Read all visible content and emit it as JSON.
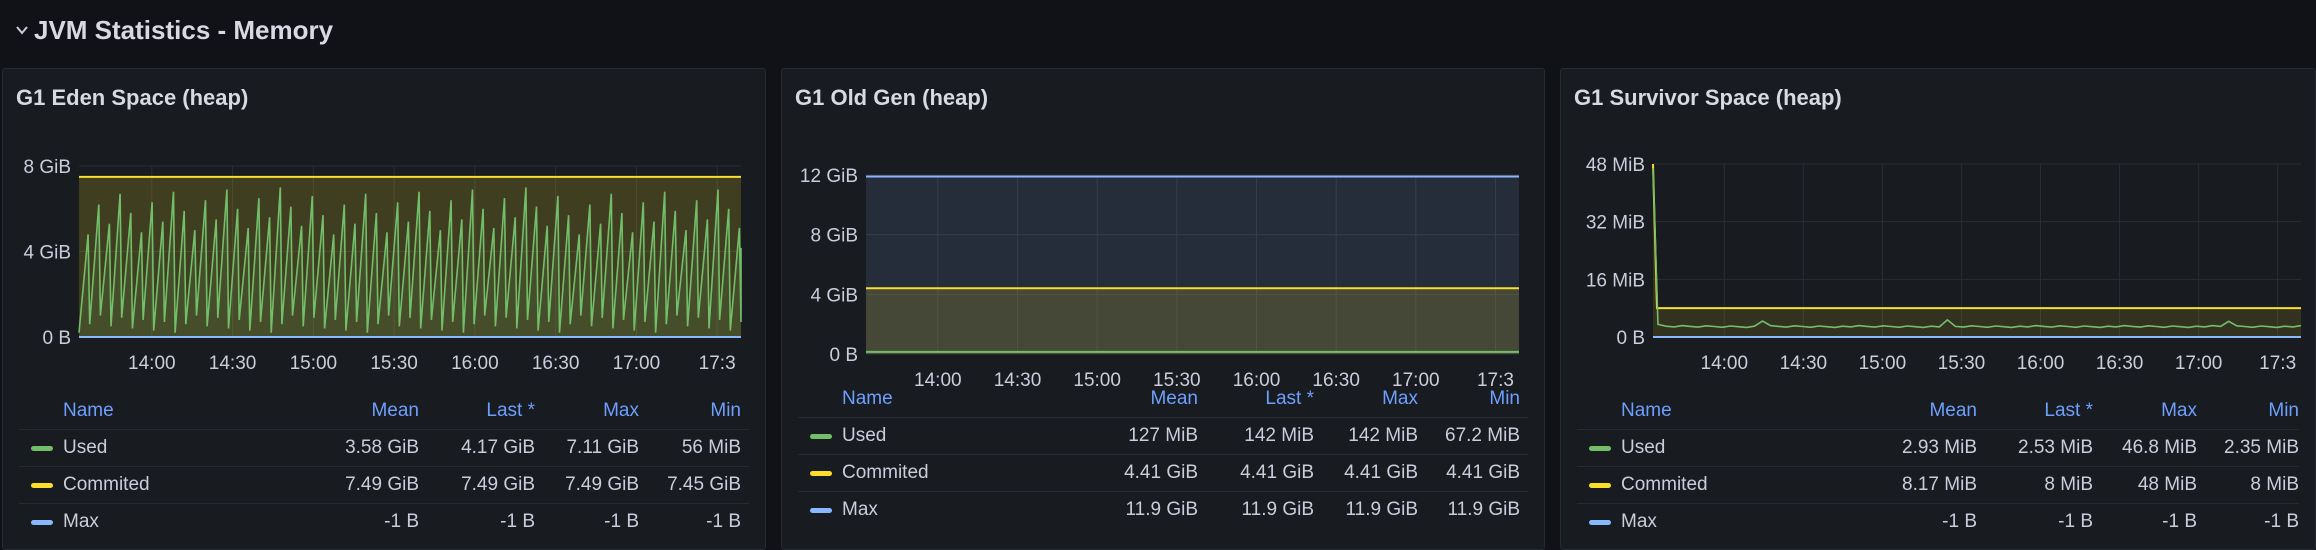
{
  "row": {
    "title": "JVM Statistics - Memory"
  },
  "legend_header": {
    "name": "Name",
    "mean": "Mean",
    "last": "Last *",
    "max": "Max",
    "min": "Min"
  },
  "colors": {
    "used": "#73bf69",
    "commited": "#fade2a",
    "max": "#8ab8ff",
    "grid": "#2a2d33",
    "axis_text": "#ccccdc"
  },
  "panels": [
    {
      "title": "G1 Eden Space (heap)",
      "chart_data": {
        "type": "line",
        "yticks": [
          "8 GiB",
          "4 GiB",
          "0 B"
        ],
        "ylim": [
          0,
          8
        ],
        "xticks": [
          "14:00",
          "14:30",
          "15:00",
          "15:30",
          "16:00",
          "16:30",
          "17:00",
          "17:3"
        ],
        "series": [
          {
            "name": "Used",
            "pattern": "sawtooth",
            "min_gib": 0.05,
            "max_gib": 7.11,
            "last_gib": 4.17
          },
          {
            "name": "Commited",
            "value_gib": 7.49
          },
          {
            "name": "Max",
            "value_gib": 0
          }
        ]
      },
      "legend": [
        {
          "name": "Used",
          "mean": "3.58 GiB",
          "last": "4.17 GiB",
          "max": "7.11 GiB",
          "min": "56 MiB"
        },
        {
          "name": "Commited",
          "mean": "7.49 GiB",
          "last": "7.49 GiB",
          "max": "7.49 GiB",
          "min": "7.45 GiB"
        },
        {
          "name": "Max",
          "mean": "-1 B",
          "last": "-1 B",
          "max": "-1 B",
          "min": "-1 B"
        }
      ]
    },
    {
      "title": "G1 Old Gen (heap)",
      "chart_data": {
        "type": "line",
        "yticks": [
          "12 GiB",
          "8 GiB",
          "4 GiB",
          "0 B"
        ],
        "ylim": [
          0,
          12
        ],
        "xticks": [
          "14:00",
          "14:30",
          "15:00",
          "15:30",
          "16:00",
          "16:30",
          "17:00",
          "17:3"
        ],
        "series": [
          {
            "name": "Used",
            "value_gib": 0.14
          },
          {
            "name": "Commited",
            "value_gib": 4.41
          },
          {
            "name": "Max",
            "value_gib": 11.9
          }
        ]
      },
      "legend": [
        {
          "name": "Used",
          "mean": "127 MiB",
          "last": "142 MiB",
          "max": "142 MiB",
          "min": "67.2 MiB"
        },
        {
          "name": "Commited",
          "mean": "4.41 GiB",
          "last": "4.41 GiB",
          "max": "4.41 GiB",
          "min": "4.41 GiB"
        },
        {
          "name": "Max",
          "mean": "11.9 GiB",
          "last": "11.9 GiB",
          "max": "11.9 GiB",
          "min": "11.9 GiB"
        }
      ]
    },
    {
      "title": "G1 Survivor Space (heap)",
      "chart_data": {
        "type": "line",
        "yticks": [
          "48 MiB",
          "32 MiB",
          "16 MiB",
          "0 B"
        ],
        "ylim": [
          0,
          48
        ],
        "xticks": [
          "14:00",
          "14:30",
          "15:00",
          "15:30",
          "16:00",
          "16:30",
          "17:00",
          "17:3"
        ],
        "series": [
          {
            "name": "Used",
            "initial_mib": 46.8,
            "typical_mib": 2.9
          },
          {
            "name": "Commited",
            "initial_mib": 48,
            "value_mib": 8
          },
          {
            "name": "Max",
            "value_mib": 0
          }
        ]
      },
      "legend": [
        {
          "name": "Used",
          "mean": "2.93 MiB",
          "last": "2.53 MiB",
          "max": "46.8 MiB",
          "min": "2.35 MiB"
        },
        {
          "name": "Commited",
          "mean": "8.17 MiB",
          "last": "8 MiB",
          "max": "48 MiB",
          "min": "8 MiB"
        },
        {
          "name": "Max",
          "mean": "-1 B",
          "last": "-1 B",
          "max": "-1 B",
          "min": "-1 B"
        }
      ]
    }
  ]
}
